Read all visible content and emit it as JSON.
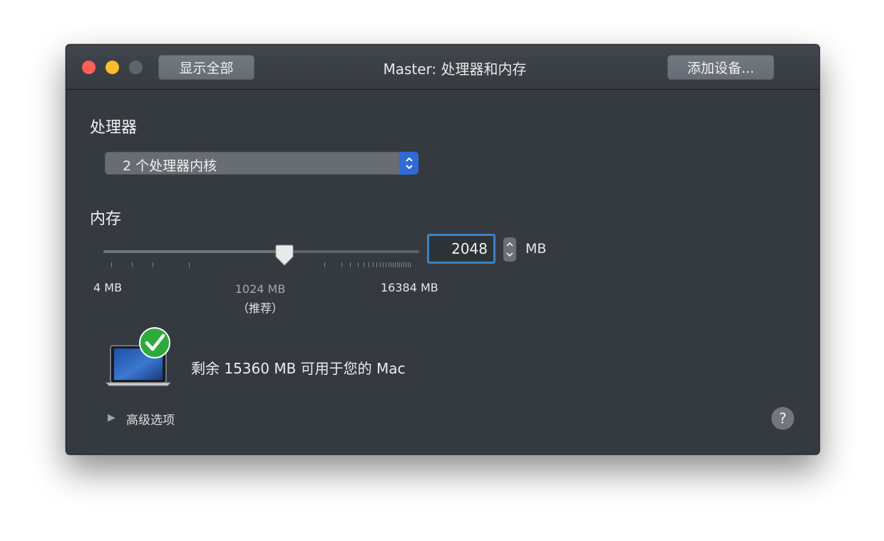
{
  "window": {
    "title": "Master: 处理器和内存",
    "show_all_label": "显示全部",
    "add_device_label": "添加设备..."
  },
  "processor": {
    "section_label": "处理器",
    "selected_option": "2 个处理器内核"
  },
  "memory": {
    "section_label": "内存",
    "slider_min_label": "4 MB",
    "slider_recommended_label": "1024 MB",
    "slider_recommended_note": "（推荐）",
    "slider_max_label": "16384 MB",
    "value": "2048",
    "unit": "MB",
    "slider_value_mb": 2048
  },
  "status": {
    "message": "剩余 15360 MB 可用于您的 Mac"
  },
  "advanced": {
    "label": "高级选项"
  },
  "help_symbol": "?",
  "colors": {
    "window_bg": "#353a40",
    "accent": "#2f6bd5",
    "focus_ring": "#3b82c4",
    "check_green": "#2eaa3c"
  },
  "icons": [
    "close-icon",
    "minimize-icon",
    "zoom-icon",
    "popup-arrows-icon",
    "slider-thumb-icon",
    "stepper-icon",
    "laptop-icon",
    "checkmark-icon",
    "disclosure-triangle-icon",
    "help-icon"
  ]
}
